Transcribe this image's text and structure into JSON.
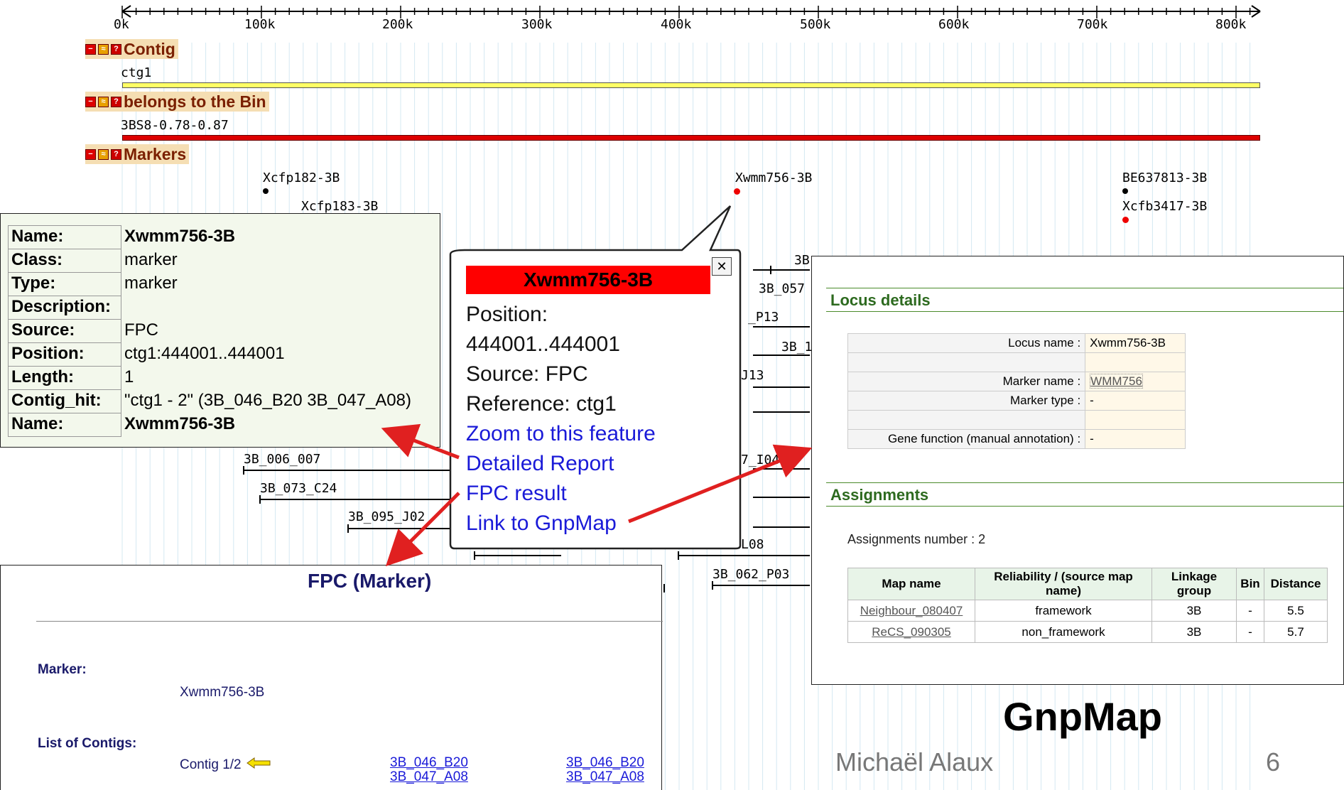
{
  "ruler": {
    "ticks": [
      "0k",
      "100k",
      "200k",
      "300k",
      "400k",
      "500k",
      "600k",
      "700k",
      "800k"
    ]
  },
  "tracks": {
    "contig": {
      "title": "Contig",
      "label": "ctg1"
    },
    "bin": {
      "title": "belongs to the Bin",
      "label": "3BS8-0.78-0.87"
    },
    "markers": {
      "title": "Markers",
      "items": [
        "Xcfp182-3B",
        "Xcfp183-3B",
        "Xwmm756-3B",
        "BE637813-3B",
        "Xcfb3417-3B"
      ]
    },
    "clone_labels": [
      "3B_006_007",
      "3B_073_C24",
      "3B_095_J02",
      "3B_062_P03",
      "3B_057",
      "_P13",
      "3B_1",
      "J13",
      "7_I04",
      "L08",
      "3B"
    ]
  },
  "detail_panel": {
    "rows": [
      {
        "key": "Name:",
        "value": "Xwmm756-3B"
      },
      {
        "key": "Class:",
        "value": "marker"
      },
      {
        "key": "Type:",
        "value": "marker"
      },
      {
        "key": "Description:",
        "value": ""
      },
      {
        "key": "Source:",
        "value": "FPC"
      },
      {
        "key": "Position:",
        "value": "ctg1:444001..444001"
      },
      {
        "key": "Length:",
        "value": "1"
      },
      {
        "key": "Contig_hit:",
        "value": "\"ctg1 - 2\" (3B_046_B20 3B_047_A08)"
      },
      {
        "key": "Name:",
        "value": "Xwmm756-3B"
      }
    ]
  },
  "popup": {
    "title": "Xwmm756-3B",
    "close": "✕",
    "position_label": "Position:",
    "position_value": "444001..444001",
    "source": "Source: FPC",
    "reference": "Reference: ctg1",
    "links": [
      "Zoom to this feature",
      "Detailed Report",
      "FPC result",
      "Link to GnpMap"
    ]
  },
  "fpc_panel": {
    "title": "FPC (Marker)",
    "marker_label": "Marker:",
    "marker_value": "Xwmm756-3B",
    "contigs_label": "List of Contigs:",
    "contig_text": "Contig 1/2",
    "clone_col1": [
      "3B_046_B20",
      "3B_047_A08"
    ],
    "clone_col2": [
      "3B_046_B20",
      "3B_047_A08"
    ]
  },
  "gnpmap_panel": {
    "locus_section": "Locus details",
    "locus_rows": [
      {
        "key": "Locus name :",
        "value": "Xwmm756-3B"
      },
      {
        "key": "",
        "value": ""
      },
      {
        "key": "Marker name :",
        "value": "WMM756"
      },
      {
        "key": "Marker type :",
        "value": "-"
      },
      {
        "key": "",
        "value": ""
      },
      {
        "key": "Gene function (manual annotation) :",
        "value": "-"
      }
    ],
    "assign_section": "Assignments",
    "assign_count": "Assignments number : 2",
    "headers": [
      "Map name",
      "Reliability / (source map name)",
      "Linkage group",
      "Bin",
      "Distance"
    ],
    "rows": [
      [
        "Neighbour_080407",
        "framework",
        "3B",
        "-",
        "5.5"
      ],
      [
        "ReCS_090305",
        "non_framework",
        "3B",
        "-",
        "5.7"
      ]
    ]
  },
  "caption": {
    "gnpmap": "GnpMap",
    "author": "Michaël Alaux",
    "page": "6"
  },
  "colors": {
    "contig_bar": "#ffff66",
    "bin_bar": "#dd0000",
    "popup_title_bg": "#ff0000",
    "link": "#1a1ad8",
    "arrow": "#e02020"
  }
}
